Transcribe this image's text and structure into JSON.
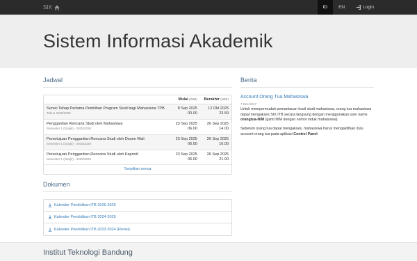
{
  "navbar": {
    "brand": "SIX",
    "lang_id": "ID",
    "lang_en": "EN",
    "login": "Login"
  },
  "jumbotron": {
    "title": "Sistem Informasi Akademik"
  },
  "jadwal": {
    "title": "Jadwal",
    "col_start": "Mulai",
    "col_end": "Berakhir",
    "tz": "(WIB)",
    "rows": [
      {
        "name": "Survei Tahap Pertama Pemilihan Program Studi bagi Mahasiswa TPB",
        "sub": "Tahun 2025/2026",
        "start_date": "8 Sep 2025",
        "start_time": "00.00",
        "end_date": "12 Okt 2025",
        "end_time": "23.59"
      },
      {
        "name": "Penggantian Rencana Studi oleh Mahasiswa",
        "sub": "Semester 1 (Ganjil) - 2025/2026",
        "start_date": "23 Sep 2025",
        "start_time": "06.00",
        "end_date": "26 Sep 2025",
        "end_time": "14.00"
      },
      {
        "name": "Persetujuan Penggantian Rencana Studi oleh Dosen Wali",
        "sub": "Semester 1 (Ganjil) - 2025/2026",
        "start_date": "23 Sep 2025",
        "start_time": "06.00",
        "end_date": "26 Sep 2025",
        "end_time": "16.00"
      },
      {
        "name": "Persetujuan Penggantian Rencana Studi oleh Kaprodi",
        "sub": "Semester 1 (Ganjil) - 2025/2026",
        "start_date": "23 Sep 2025",
        "start_time": "06.00",
        "end_date": "26 Sep 2025",
        "end_time": "21.00"
      }
    ],
    "show_all": "Tampilkan semua"
  },
  "dokumen": {
    "title": "Dokumen",
    "items": [
      "Kalender Pendidikan ITB 2025-2026",
      "Kalender Pendidikan ITB 2024-2025",
      "Kalender Pendidikan ITB 2023-2024 (Revisi)"
    ]
  },
  "berita": {
    "title": "Berita",
    "news_title": "Account Orang Tua Mahasiswa",
    "date": "7 Des 2017",
    "p1_a": "Untuk mempermudah pemantauan hasil studi mahasiswa, orang tua mahasiswa dapat mengakses SIX ITB secara langsung dengan menggunakan user name ",
    "p1_b": "orangtua-NIM",
    "p1_c": " (ganti NIM dengan nomor induk mahasiswa).",
    "p2_a": "Sebelum orang tua dapat mengakses, mahasiswa harus mengaktifkan dulu account orang tua pada aplikasi ",
    "p2_b": "Control Panel",
    "p2_c": "."
  },
  "footer": {
    "title": "Institut Teknologi Bandung"
  }
}
